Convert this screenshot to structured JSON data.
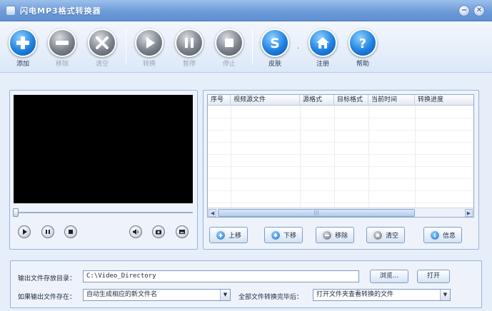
{
  "window": {
    "title": "闪电MP3格式转换器",
    "minimize_glyph": "−",
    "close_glyph": "✕"
  },
  "toolbar": {
    "add": "添加",
    "remove": "移除",
    "clear": "清空",
    "convert": "转换",
    "pause": "暂停",
    "stop": "停止",
    "skin": "皮肤",
    "register": "注册",
    "help": "帮助",
    "separator_dot": "·"
  },
  "file_list": {
    "columns": [
      "序号",
      "视频源文件",
      "源格式",
      "目标格式",
      "当前时间",
      "转换进度"
    ],
    "rows": [],
    "scroll_grip": "|||"
  },
  "actions": {
    "move_up": "上移",
    "move_down": "下移",
    "remove": "移除",
    "clear": "清空",
    "info": "信息"
  },
  "output": {
    "dir_label": "输出文件存放目录：",
    "dir_value": "C:\\Video_Directory",
    "browse_label": "浏览...",
    "open_label": "打开",
    "exists_label": "如果输出文件存在：",
    "exists_value": "自动生成相应的新文件名",
    "after_label": "全部文件转换完毕后：",
    "after_value": "打开文件夹查看转换的文件"
  },
  "icons": {
    "add": "plus-icon",
    "remove": "minus-icon",
    "clear": "x-icon",
    "convert": "play-icon",
    "pause": "pause-icon",
    "stop": "stop-icon",
    "skin": "skin-s-icon",
    "register": "home-icon",
    "help": "question-icon"
  },
  "colors": {
    "titlebar": "#6e9bd8",
    "accent_blue": "#1f82e0",
    "disabled_gray": "#7b828c",
    "video_bg": "#000000"
  }
}
